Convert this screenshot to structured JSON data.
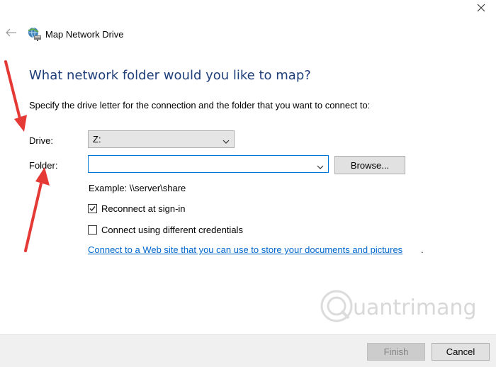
{
  "window": {
    "title": "Map Network Drive",
    "icon": "network-drive-icon",
    "close_icon": "close-icon",
    "back_icon": "back-arrow-icon"
  },
  "heading": "What network folder would you like to map?",
  "instruction": "Specify the drive letter for the connection and the folder that you want to connect to:",
  "drive": {
    "label": "Drive:",
    "value": "Z:"
  },
  "folder": {
    "label": "Folder:",
    "value": "",
    "browse_label": "Browse..."
  },
  "example": "Example: \\\\server\\share",
  "options": {
    "reconnect": {
      "label": "Reconnect at sign-in",
      "checked": true
    },
    "credentials": {
      "label": "Connect using different credentials",
      "checked": false
    }
  },
  "link": {
    "text": "Connect to a Web site that you can use to store your documents and pictures",
    "suffix": "."
  },
  "watermark": "uantrimang",
  "footer": {
    "finish_label": "Finish",
    "cancel_label": "Cancel"
  },
  "colors": {
    "heading": "#1f3f7a",
    "link": "#0066cc",
    "annotation_arrow": "#e53935",
    "focus_border": "#0078d7"
  }
}
